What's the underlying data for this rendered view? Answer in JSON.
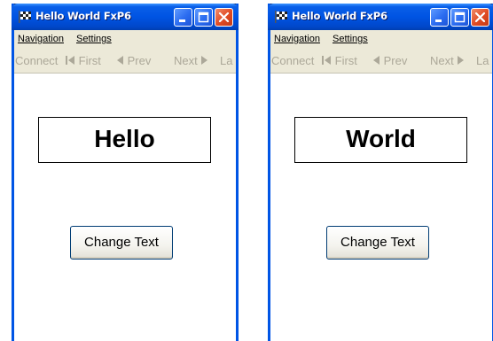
{
  "windows": [
    {
      "title": "Hello World FxP6",
      "menu": {
        "navigation": "Navigation",
        "settings": "Settings"
      },
      "toolbar": {
        "connect": "Connect",
        "first": "First",
        "prev": "Prev",
        "next": "Next",
        "last": "La"
      },
      "label_text": "Hello",
      "button_label": "Change Text"
    },
    {
      "title": "Hello World FxP6",
      "menu": {
        "navigation": "Navigation",
        "settings": "Settings"
      },
      "toolbar": {
        "connect": "Connect",
        "first": "First",
        "prev": "Prev",
        "next": "Next",
        "last": "La"
      },
      "label_text": "World",
      "button_label": "Change Text"
    }
  ],
  "icons": {
    "app": "checkered-flag-icon",
    "minimize": "minimize-icon",
    "maximize": "maximize-icon",
    "close": "close-icon",
    "first": "first-arrow-icon",
    "prev": "prev-arrow-icon",
    "next": "next-arrow-icon"
  },
  "colors": {
    "titlebar": "#0054e3",
    "window_frame": "#0055e5",
    "close_button": "#e04a22",
    "menubar_bg": "#ece9d8",
    "disabled_text": "#aca899",
    "button_border": "#003c74"
  }
}
